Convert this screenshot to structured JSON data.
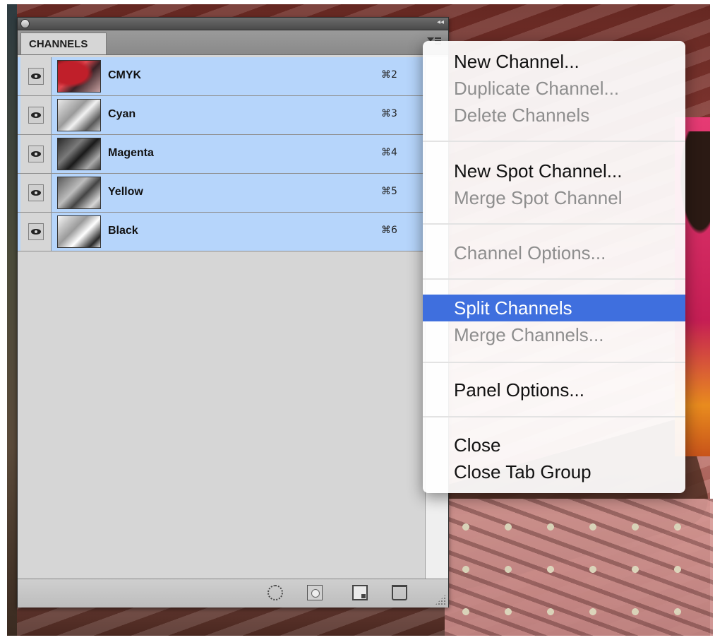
{
  "panel": {
    "tab_label": "CHANNELS",
    "channels": [
      {
        "name": "CMYK",
        "shortcut": "⌘2",
        "visible": true
      },
      {
        "name": "Cyan",
        "shortcut": "⌘3",
        "visible": true
      },
      {
        "name": "Magenta",
        "shortcut": "⌘4",
        "visible": true
      },
      {
        "name": "Yellow",
        "shortcut": "⌘5",
        "visible": true
      },
      {
        "name": "Black",
        "shortcut": "⌘6",
        "visible": true
      }
    ],
    "collapse_glyph": "◂◂",
    "footer_icons": [
      "load-channel-as-selection-icon",
      "save-selection-as-channel-icon",
      "new-channel-icon",
      "trash-icon"
    ]
  },
  "menu": {
    "items": [
      {
        "label": "New Channel...",
        "enabled": true
      },
      {
        "label": "Duplicate Channel...",
        "enabled": false
      },
      {
        "label": "Delete Channels",
        "enabled": false
      },
      {
        "label": "New Spot Channel...",
        "enabled": true
      },
      {
        "label": "Merge Spot Channel",
        "enabled": false
      },
      {
        "label": "Channel Options...",
        "enabled": false
      },
      {
        "label": "Split Channels",
        "enabled": true,
        "selected": true
      },
      {
        "label": "Merge Channels...",
        "enabled": false
      },
      {
        "label": "Panel Options...",
        "enabled": true
      },
      {
        "label": "Close",
        "enabled": true
      },
      {
        "label": "Close Tab Group",
        "enabled": true
      }
    ]
  },
  "colors": {
    "row_selected": "#b6d5fb",
    "menu_highlight": "#3f6fde",
    "disabled_text": "#8e8e8e"
  }
}
